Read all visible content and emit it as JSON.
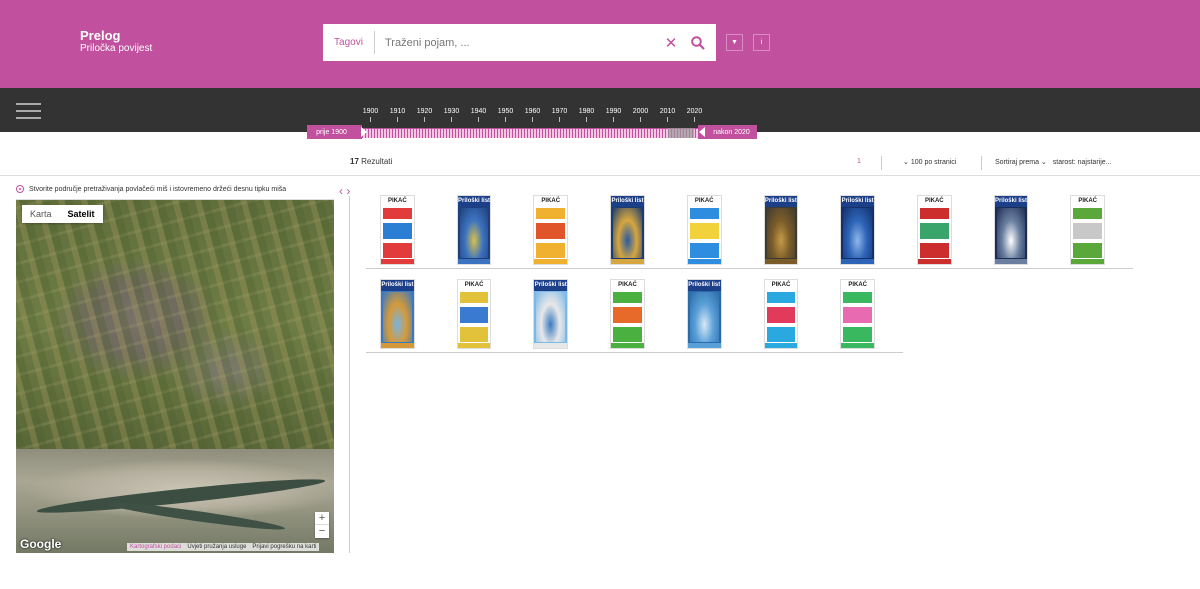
{
  "header": {
    "title": "Prelog",
    "subtitle": "Priločka povijest",
    "search_tags_label": "Tagovi",
    "search_placeholder": "Traženi pojam, ...",
    "btn_filter": "▼",
    "btn_info": "i",
    "accent": "#c1519e"
  },
  "timeline": {
    "years": [
      "1900",
      "1910",
      "1920",
      "1930",
      "1940",
      "1950",
      "1960",
      "1970",
      "1980",
      "1990",
      "2000",
      "2010",
      "2020"
    ],
    "before_label": "prije 1900",
    "after_label": "nakon 2020"
  },
  "results": {
    "count": "17",
    "count_label": "Rezultati",
    "page": "1",
    "per_page": "100 po stranici",
    "sort_label": "Sortiraj prema",
    "sort_value": "starost: najstarije..."
  },
  "map": {
    "hint": "Stvorite područje pretraživanja povlačeći miš i istovremeno držeći desnu tipku miša",
    "tab_map": "Karta",
    "tab_satellite": "Satelit",
    "zoom_in": "+",
    "zoom_out": "−",
    "logo": "Google",
    "footer": [
      "Kartografski podaci",
      "Uvjeti pružanja usluge",
      "Prijavi pogrešku na karti"
    ]
  },
  "thumbnails": [
    {
      "mast": "PIKAĆ",
      "style": "pikac",
      "colors": [
        "#ffffff",
        "#e23b3b",
        "#2a7fd4"
      ]
    },
    {
      "mast": "Priloški list",
      "style": "blue",
      "colors": [
        "#1f3f7a",
        "#3c73c0",
        "#d8c04a"
      ]
    },
    {
      "mast": "PIKAĆ",
      "style": "pikac",
      "colors": [
        "#ffffff",
        "#f0b030",
        "#e0562a"
      ]
    },
    {
      "mast": "Priloški list",
      "style": "blue",
      "colors": [
        "#1a3c6e",
        "#d6a640",
        "#2a5aa0"
      ]
    },
    {
      "mast": "PIKAĆ",
      "style": "pikac",
      "colors": [
        "#ffffff",
        "#2f8de0",
        "#f1d23a"
      ]
    },
    {
      "mast": "Priloški list",
      "style": "blue",
      "colors": [
        "#3e3a30",
        "#7a5c2a",
        "#c69a48"
      ]
    },
    {
      "mast": "Priloški list",
      "style": "blue",
      "colors": [
        "#14306a",
        "#2d64b8",
        "#8fb7e8"
      ]
    },
    {
      "mast": "PIKAĆ",
      "style": "pikac",
      "colors": [
        "#ffffff",
        "#cc2e2e",
        "#3aa56a"
      ]
    },
    {
      "mast": "Priloški list",
      "style": "blue",
      "colors": [
        "#1c2d55",
        "#6a7fa0",
        "#ffffff"
      ]
    },
    {
      "mast": "PIKAĆ",
      "style": "pikac",
      "colors": [
        "#ffffff",
        "#5aa83a",
        "#c8c8c8"
      ]
    },
    {
      "mast": "Priloški list",
      "style": "blue",
      "colors": [
        "#3a78c0",
        "#d49a3a",
        "#7ab4e0"
      ]
    },
    {
      "mast": "PIKAĆ",
      "style": "pikac",
      "colors": [
        "#ffffff",
        "#e2c23a",
        "#3a7ad0"
      ]
    },
    {
      "mast": "Priloški list",
      "style": "blue",
      "colors": [
        "#7ab8e8",
        "#e8e8e8",
        "#3a7ac0"
      ]
    },
    {
      "mast": "PIKAĆ",
      "style": "pikac",
      "colors": [
        "#ffffff",
        "#4ab040",
        "#e86a2a"
      ]
    },
    {
      "mast": "Priloški list",
      "style": "blue",
      "colors": [
        "#2a6aa8",
        "#5aa0d8",
        "#d8e8f4"
      ]
    },
    {
      "mast": "PIKAĆ",
      "style": "pikac",
      "colors": [
        "#ffffff",
        "#2aa8e0",
        "#e23a5a"
      ]
    },
    {
      "mast": "PIKAĆ",
      "style": "pikac",
      "colors": [
        "#ffffff",
        "#3ab860",
        "#e86ab0"
      ]
    }
  ]
}
